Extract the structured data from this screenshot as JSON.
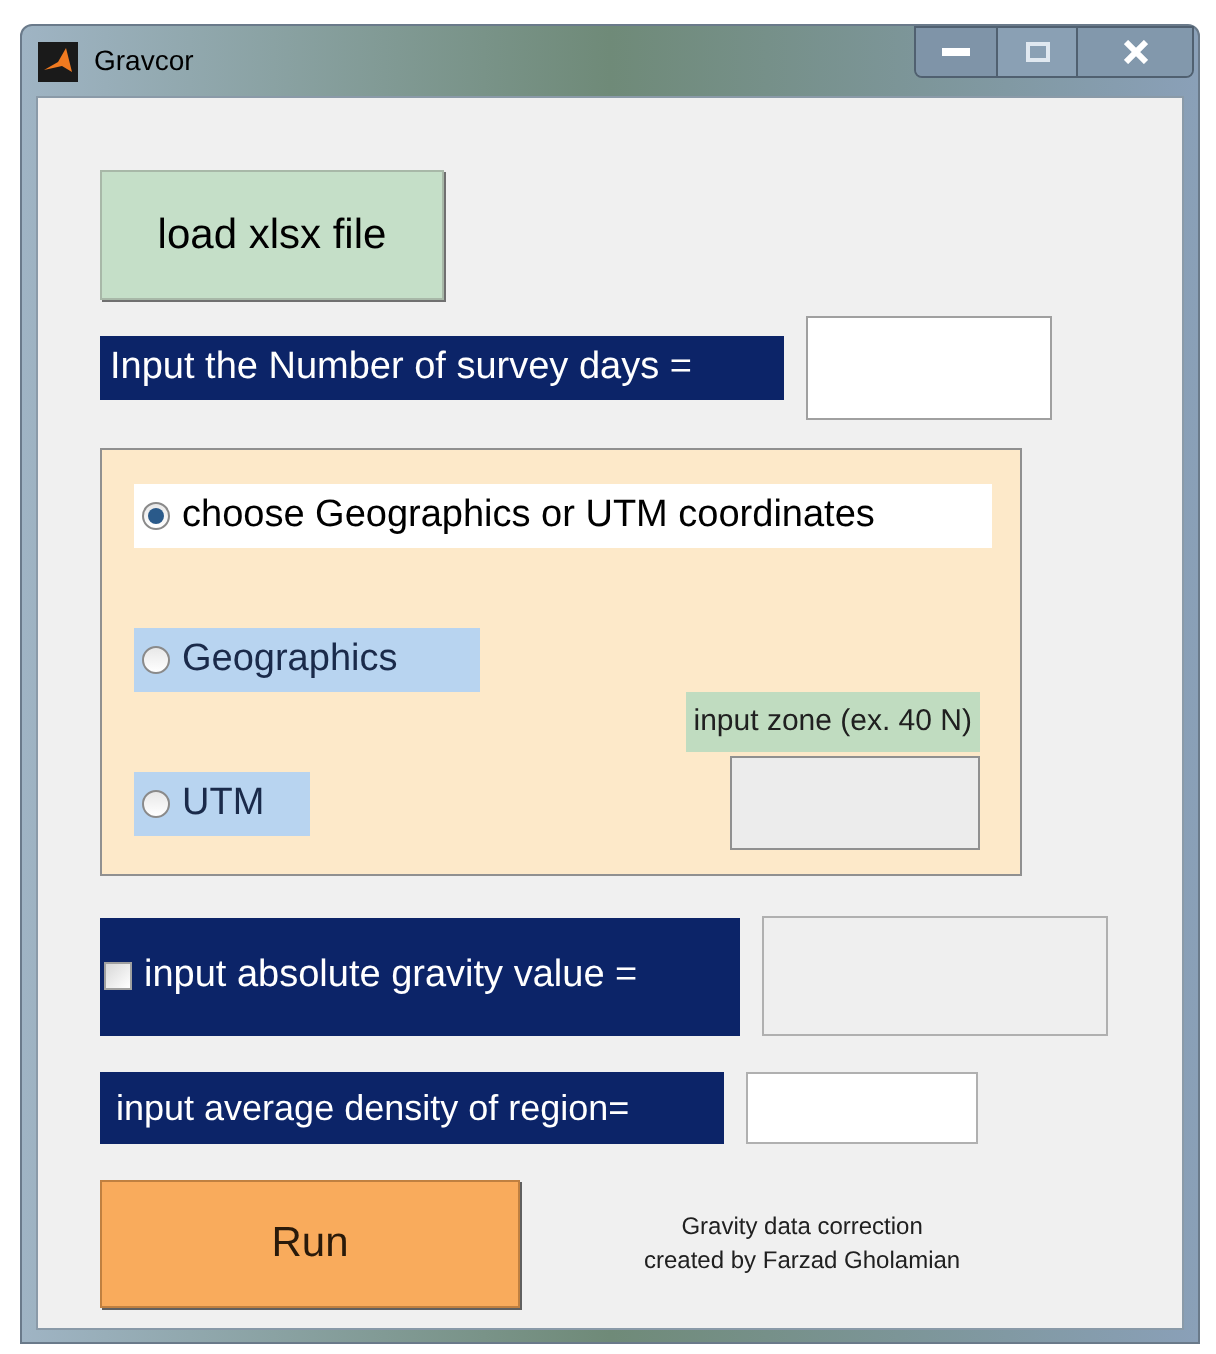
{
  "window": {
    "title": "Gravcor"
  },
  "load_button": {
    "label": "load xlsx file"
  },
  "survey_days": {
    "label": "Input the Number of survey days ="
  },
  "coordinates": {
    "options": [
      {
        "label": "choose Geographics or UTM coordinates",
        "selected": true
      },
      {
        "label": "Geographics",
        "selected": false
      },
      {
        "label": "UTM",
        "selected": false
      }
    ],
    "zone_label": "input zone (ex. 40 N)"
  },
  "absolute_gravity": {
    "label": "input absolute gravity value =",
    "checked": false
  },
  "density": {
    "label": "input average density of region="
  },
  "run_button": {
    "label": "Run"
  },
  "credit": [
    "Gravity data correction",
    "created by Farzad Gholamian"
  ]
}
